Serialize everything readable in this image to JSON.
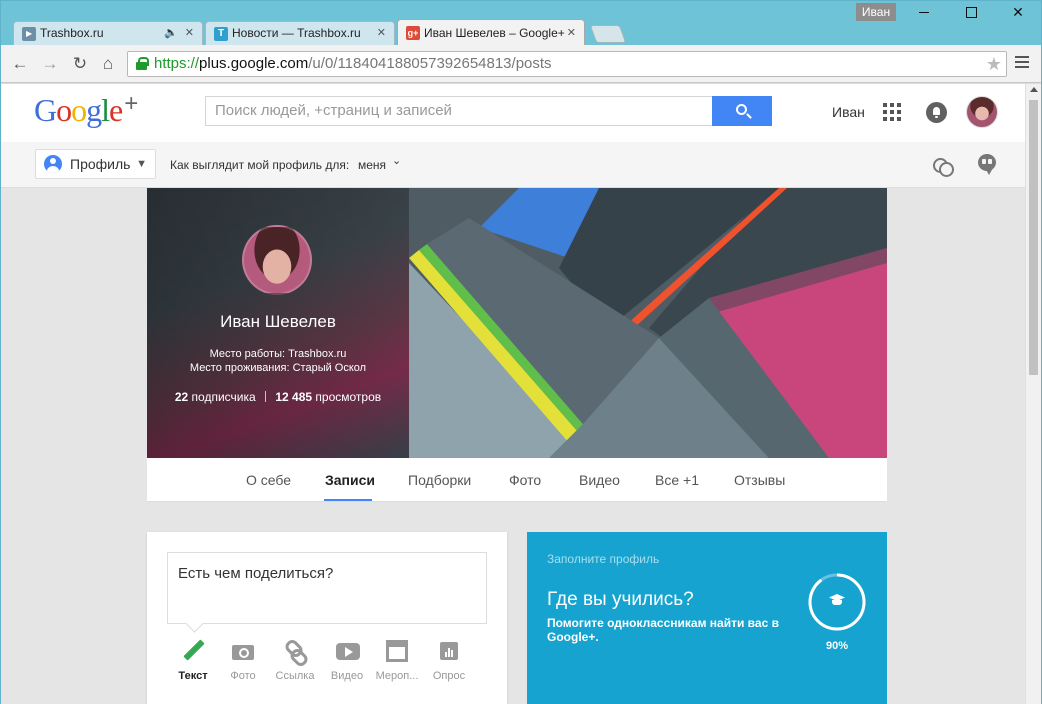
{
  "window": {
    "user_badge": "Иван",
    "tabs": [
      {
        "title": "Trashbox.ru",
        "icon": "trashbox-favicon",
        "close": "✕",
        "audio": "🔈"
      },
      {
        "title": "Новости — Trashbox.ru",
        "icon": "trashbox-favicon",
        "close": "✕"
      },
      {
        "title": "Иван Шевелев – Google+",
        "icon": "google-plus-favicon",
        "close": "✕"
      }
    ],
    "active_tab": 2
  },
  "browser": {
    "url_scheme": "https://",
    "url_host": "plus.google.com",
    "url_path": "/u/0/118404188057392654813/posts",
    "scheme_color": "#1e9b2a"
  },
  "header": {
    "logo": {
      "g": "G",
      "o1": "o",
      "o2": "o",
      "g2": "g",
      "l": "l",
      "e": "e",
      "plus": "+"
    },
    "search_placeholder": "Поиск людей, +страниц и записей",
    "username": "Иван",
    "accent_color": "#4285f4"
  },
  "subheader": {
    "profile_button": "Профиль",
    "view_as_label": "Как выглядит мой профиль для:",
    "view_as_value": "меня"
  },
  "profile": {
    "name": "Иван Шевелев",
    "work": "Место работы: Trashbox.ru",
    "home": "Место проживания: Старый Оскол",
    "followers_count": "22",
    "followers_label": "подписчика",
    "views_count": "12 485",
    "views_label": "просмотров"
  },
  "profile_tabs": [
    {
      "label": "О себе",
      "active": false
    },
    {
      "label": "Записи",
      "active": true
    },
    {
      "label": "Подборки",
      "active": false
    },
    {
      "label": "Фото",
      "active": false
    },
    {
      "label": "Видео",
      "active": false
    },
    {
      "label": "Все +1",
      "active": false
    },
    {
      "label": "Отзывы",
      "active": false
    }
  ],
  "share": {
    "placeholder": "Есть чем поделиться?",
    "actions": [
      {
        "label": "Текст",
        "icon": "pencil-icon",
        "active": true
      },
      {
        "label": "Фото",
        "icon": "camera-icon"
      },
      {
        "label": "Ссылка",
        "icon": "link-icon"
      },
      {
        "label": "Видео",
        "icon": "video-icon"
      },
      {
        "label": "Мероп...",
        "icon": "event-icon"
      },
      {
        "label": "Опрос",
        "icon": "poll-icon"
      }
    ]
  },
  "promo": {
    "kicker": "Заполните профиль",
    "title": "Где вы учились?",
    "text": "Помогите одноклассникам найти вас в Google+.",
    "progress_label": "90%",
    "progress": 0.9,
    "color": "#16a3d0"
  }
}
